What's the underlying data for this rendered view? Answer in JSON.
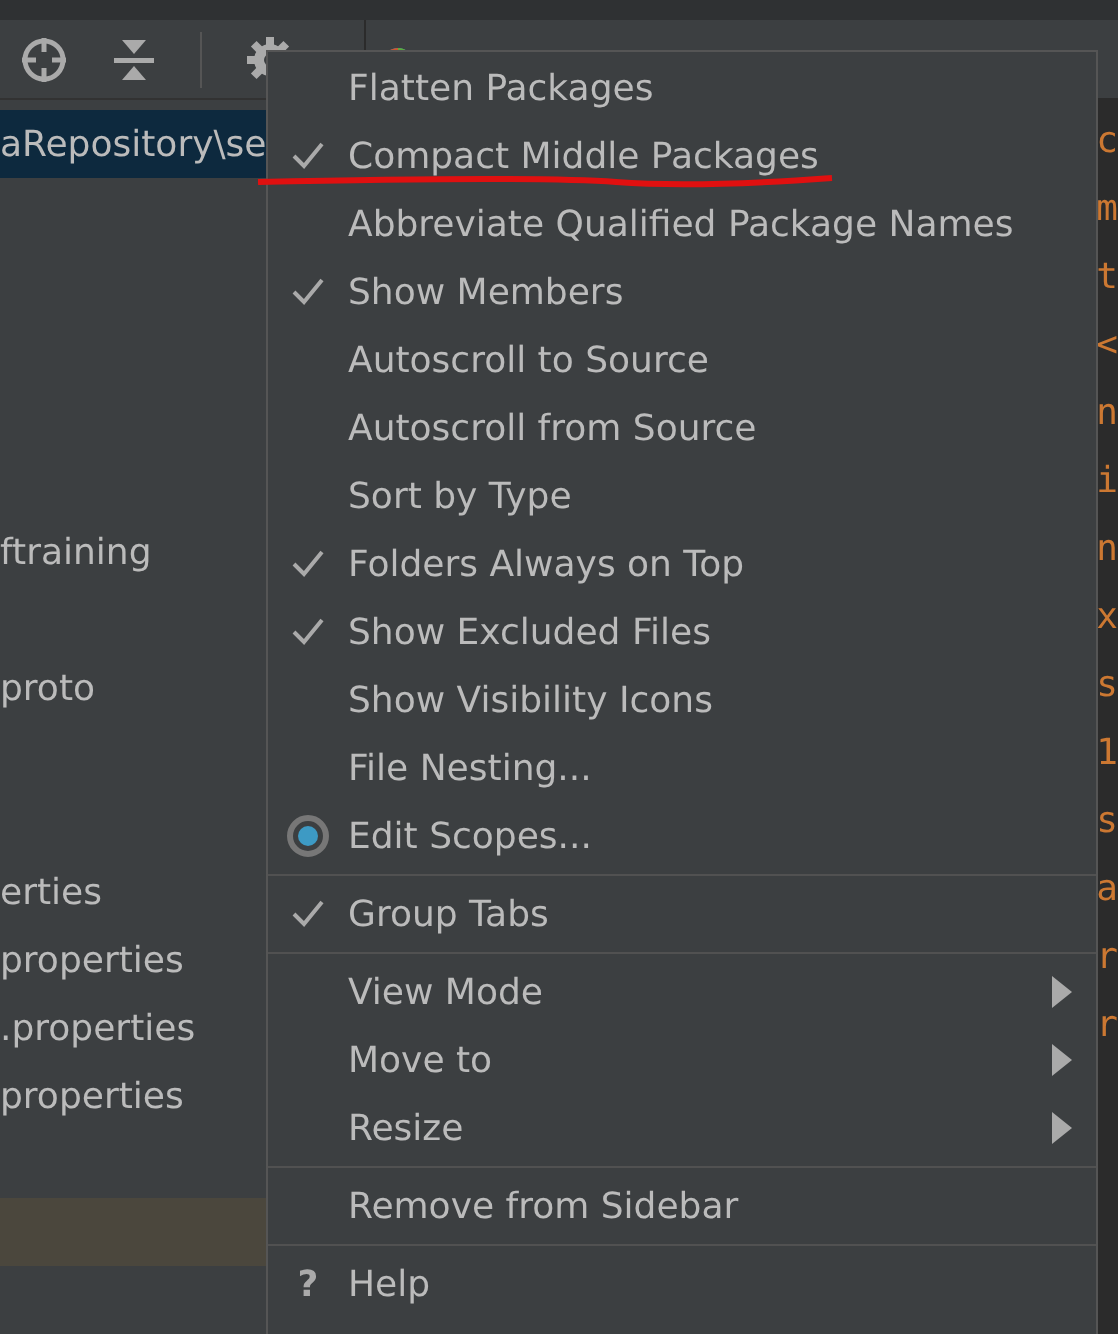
{
  "project_tree": {
    "rows": [
      {
        "label": "aRepository\\se",
        "selected": true
      },
      {
        "selected": false
      },
      {
        "selected": false
      },
      {
        "selected": false
      },
      {
        "selected": false
      },
      {
        "selected": false
      },
      {
        "label": "ftraining",
        "selected": false
      },
      {
        "selected": false
      },
      {
        "label": "proto",
        "selected": false
      },
      {
        "selected": false
      },
      {
        "selected": false
      },
      {
        "label": "erties",
        "selected": false
      },
      {
        "label": "properties",
        "selected": false
      },
      {
        "label": ".properties",
        "selected": false
      },
      {
        "label": "properties",
        "selected": false
      },
      {
        "selected": false
      },
      {
        "selected": false,
        "highlighted": true
      }
    ]
  },
  "editor": {
    "fragments": [
      "c",
      "m",
      "t",
      "<",
      "n",
      "i",
      "n",
      "x",
      "s",
      "1",
      "s",
      "a",
      "r",
      "r"
    ]
  },
  "menu": {
    "items": [
      {
        "kind": "check",
        "label": "Flatten Packages",
        "checked": false
      },
      {
        "kind": "check",
        "label": "Compact Middle Packages",
        "checked": true,
        "annotated": true
      },
      {
        "kind": "check",
        "label": "Abbreviate Qualified Package Names",
        "checked": false
      },
      {
        "kind": "check",
        "label": "Show Members",
        "checked": true
      },
      {
        "kind": "check",
        "label": "Autoscroll to Source",
        "checked": false
      },
      {
        "kind": "check",
        "label": "Autoscroll from Source",
        "checked": false
      },
      {
        "kind": "check",
        "label": "Sort by Type",
        "checked": false
      },
      {
        "kind": "check",
        "label": "Folders Always on Top",
        "checked": true
      },
      {
        "kind": "check",
        "label": "Show Excluded Files",
        "checked": true
      },
      {
        "kind": "check",
        "label": "Show Visibility Icons",
        "checked": false
      },
      {
        "kind": "check",
        "label": "File Nesting...",
        "checked": false
      },
      {
        "kind": "radio",
        "label": "Edit Scopes...",
        "selected": true
      },
      {
        "kind": "separator"
      },
      {
        "kind": "check",
        "label": "Group Tabs",
        "checked": true
      },
      {
        "kind": "separator"
      },
      {
        "kind": "submenu",
        "label": "View Mode"
      },
      {
        "kind": "submenu",
        "label": "Move to"
      },
      {
        "kind": "submenu",
        "label": "Resize"
      },
      {
        "kind": "separator"
      },
      {
        "kind": "check",
        "label": "Remove from Sidebar",
        "checked": false
      },
      {
        "kind": "separator"
      },
      {
        "kind": "help",
        "icon": "?",
        "label": "Help"
      }
    ]
  }
}
